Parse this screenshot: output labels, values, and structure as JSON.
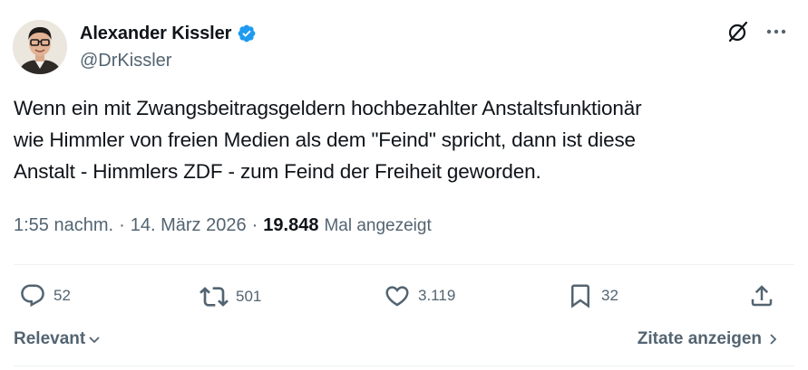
{
  "author": {
    "display_name": "Alexander Kissler",
    "handle": "@DrKissler",
    "verified_icon": "verified-badge-icon"
  },
  "tweet": {
    "lines": [
      "Wenn ein mit Zwangsbeitragsgeldern hochbezahlter Anstaltsfunktionär",
      "wie Himmler von freien Medien als dem \"Feind\" spricht, dann ist diese",
      "Anstalt - Himmlers ZDF - zum Feind der Freiheit geworden."
    ]
  },
  "meta": {
    "time": "1:55 nachm.",
    "separator": "·",
    "date": "14. März 2026",
    "views_count": "19.848",
    "views_label": "Mal angezeigt"
  },
  "actions": {
    "replies": "52",
    "reposts": "501",
    "likes": "3.119",
    "bookmarks": "32"
  },
  "footer": {
    "sort_label": "Relevant",
    "quotes_label": "Zitate anzeigen"
  },
  "colors": {
    "text_primary": "#0f1419",
    "text_secondary": "#536471",
    "verified_blue": "#1d9bf0",
    "divider": "#eff3f4"
  }
}
